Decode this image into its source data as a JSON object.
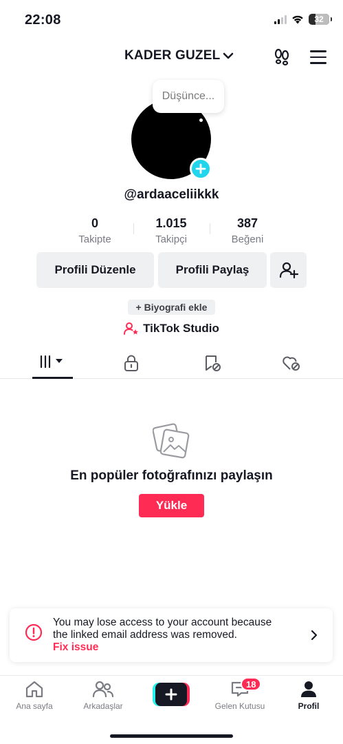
{
  "status_bar": {
    "time": "22:08",
    "battery": "32"
  },
  "header": {
    "username": "KADER GUZEL"
  },
  "profile": {
    "thought_bubble": "Düşünce...",
    "handle": "@ardaaceliikkk"
  },
  "stats": [
    {
      "value": "0",
      "label": "Takipte"
    },
    {
      "value": "1.015",
      "label": "Takipçi"
    },
    {
      "value": "387",
      "label": "Beğeni"
    }
  ],
  "actions": {
    "edit_profile": "Profili Düzenle",
    "share_profile": "Profili Paylaş"
  },
  "bio": {
    "add_label": "+ Biyografi ekle"
  },
  "studio": {
    "label": "TikTok Studio"
  },
  "empty_state": {
    "title": "En popüler fotoğrafınızı paylaşın",
    "upload_label": "Yükle"
  },
  "notice": {
    "message": "You may lose access to your account because the linked email address was removed.",
    "action": "Fix issue"
  },
  "bottom_nav": {
    "home": "Ana sayfa",
    "friends": "Arkadaşlar",
    "inbox": "Gelen Kutusu",
    "inbox_badge": "18",
    "profile": "Profil"
  },
  "colors": {
    "accent": "#fe2c55",
    "avatar_add": "#20d5ec",
    "text_primary": "#161823",
    "text_secondary": "#7a7b82",
    "button_bg": "#eff0f1"
  },
  "icons": {
    "header": [
      "chevron-down-icon",
      "footprint-icon",
      "menu-icon"
    ],
    "tabs": [
      "grid-icon",
      "lock-icon",
      "bookmark-icon",
      "liked-heart-icon"
    ],
    "nav": [
      "home-icon",
      "friends-icon",
      "plus-icon",
      "inbox-icon",
      "profile-icon"
    ]
  }
}
